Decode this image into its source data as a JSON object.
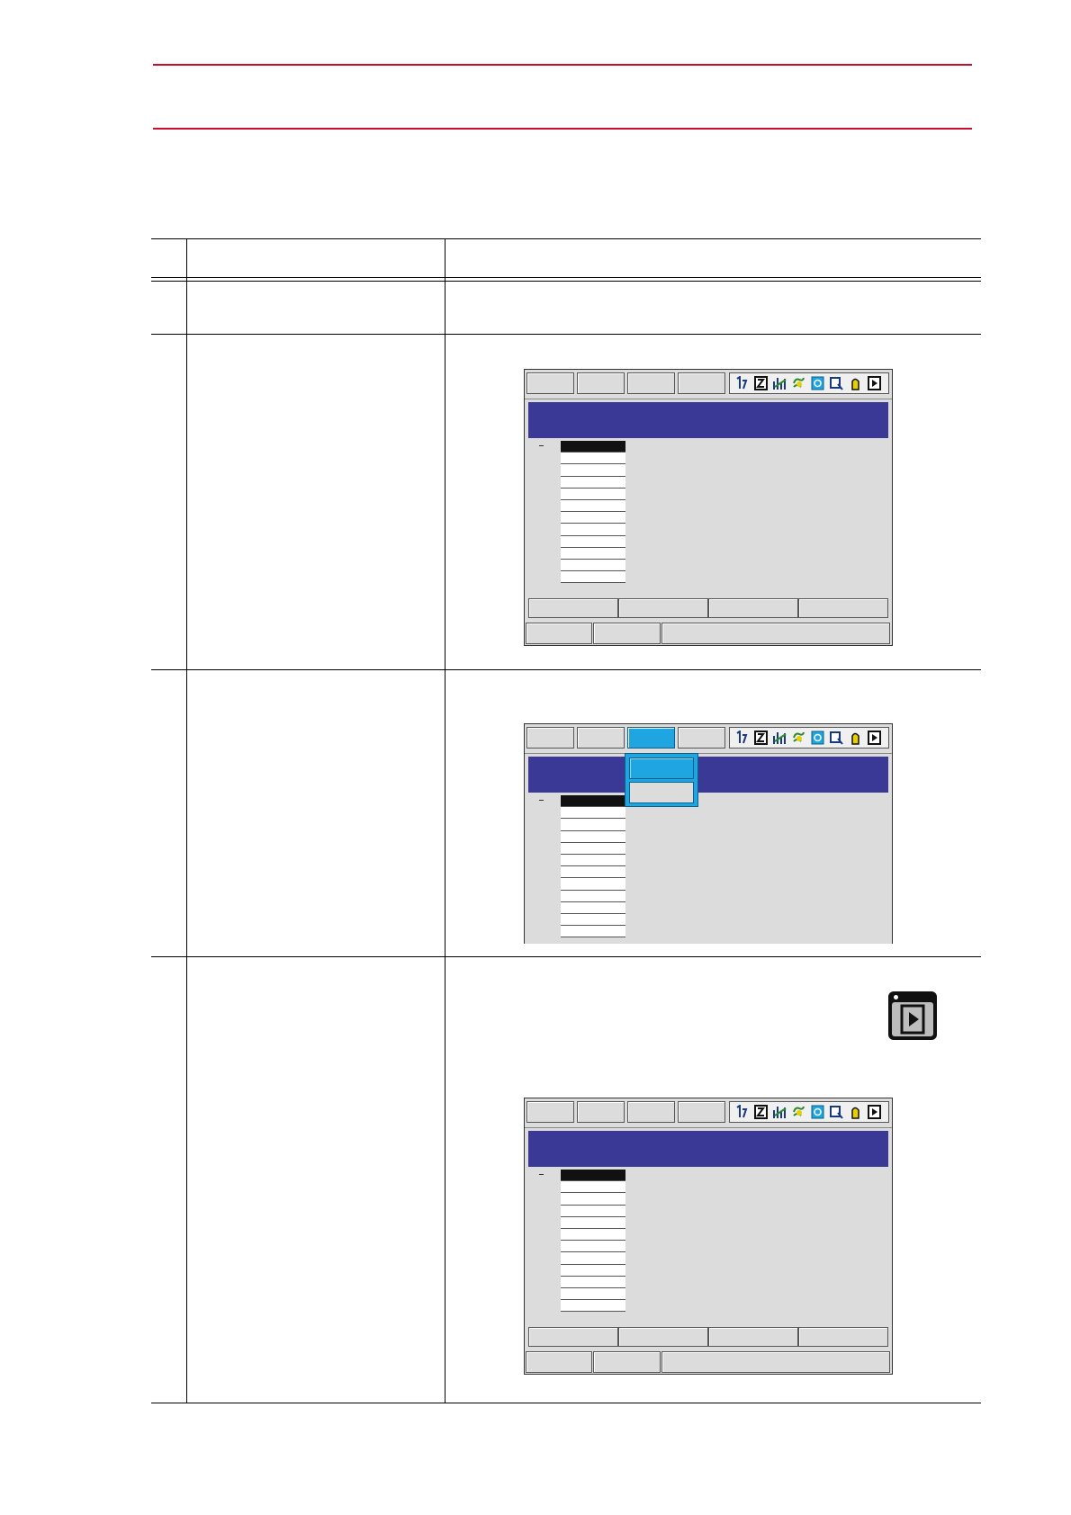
{
  "page": {
    "title": "",
    "section_heading": ""
  },
  "colors": {
    "rule_red": "#c8102e",
    "title_band_blue": "#3a3a96",
    "menu_active_blue": "#1fa6e0",
    "screen_gray": "#dcdcdc"
  },
  "table": {
    "header": {
      "step_label": "",
      "operation_label": "",
      "explanation_label": ""
    },
    "steps": [
      {
        "number": "",
        "operation": "",
        "explanation": ""
      },
      {
        "number": "",
        "operation": "",
        "explanation": ""
      },
      {
        "number": "",
        "operation": "",
        "explanation": ""
      },
      {
        "number": "",
        "operation": "",
        "explanation": ""
      }
    ]
  },
  "screens": {
    "status_icons": [
      "teach-mode-icon",
      "step-icon",
      "speed-icon",
      "cycle-icon",
      "coordinate-icon",
      "tool-icon",
      "servo-icon",
      "play-icon"
    ],
    "second_screen_dropdown": {
      "open_menu_index": 2,
      "items": [
        "",
        ""
      ],
      "selected_index": 0
    }
  },
  "keys": {
    "play_key_icon": "play-key-icon"
  }
}
